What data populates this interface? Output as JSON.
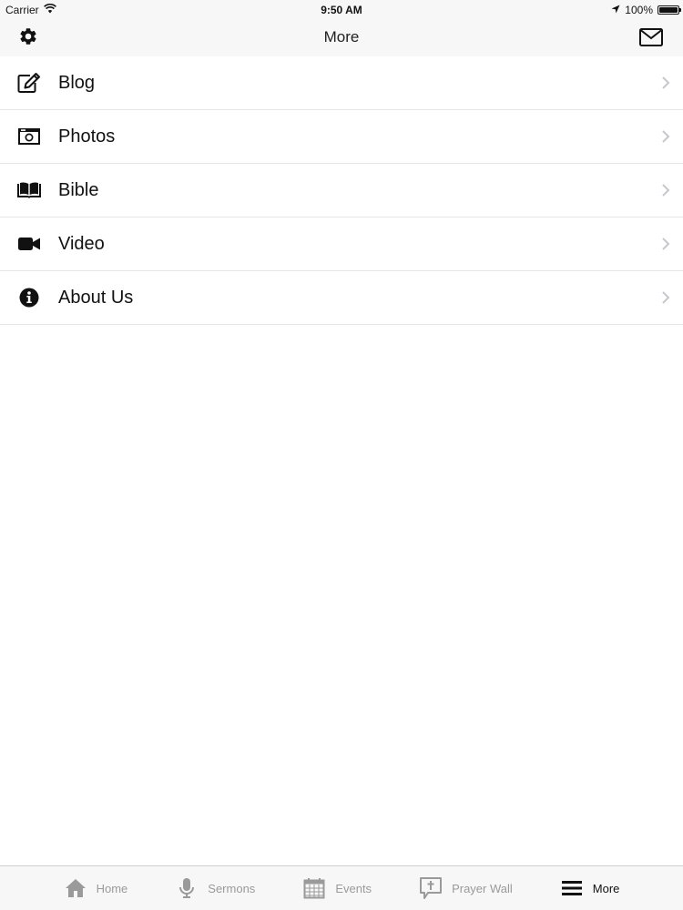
{
  "status_bar": {
    "carrier": "Carrier",
    "time": "9:50 AM",
    "battery": "100%"
  },
  "nav": {
    "title": "More",
    "left_icon": "gear-icon",
    "right_icon": "mail-icon"
  },
  "menu": [
    {
      "label": "Blog",
      "icon": "edit-icon"
    },
    {
      "label": "Photos",
      "icon": "camera-icon"
    },
    {
      "label": "Bible",
      "icon": "book-icon"
    },
    {
      "label": "Video",
      "icon": "video-camera-icon"
    },
    {
      "label": "About Us",
      "icon": "info-icon"
    }
  ],
  "tabs": [
    {
      "label": "Home",
      "icon": "home-icon",
      "active": false
    },
    {
      "label": "Sermons",
      "icon": "microphone-icon",
      "active": false
    },
    {
      "label": "Events",
      "icon": "calendar-icon",
      "active": false
    },
    {
      "label": "Prayer Wall",
      "icon": "prayer-bubble-icon",
      "active": false
    },
    {
      "label": "More",
      "icon": "menu-icon",
      "active": true
    }
  ],
  "colors": {
    "bar_background": "#f7f7f7",
    "separator": "#e6e6e6",
    "inactive_tab": "#9a9a9a",
    "active_tab": "#111111",
    "chevron": "#c7c7cc"
  }
}
